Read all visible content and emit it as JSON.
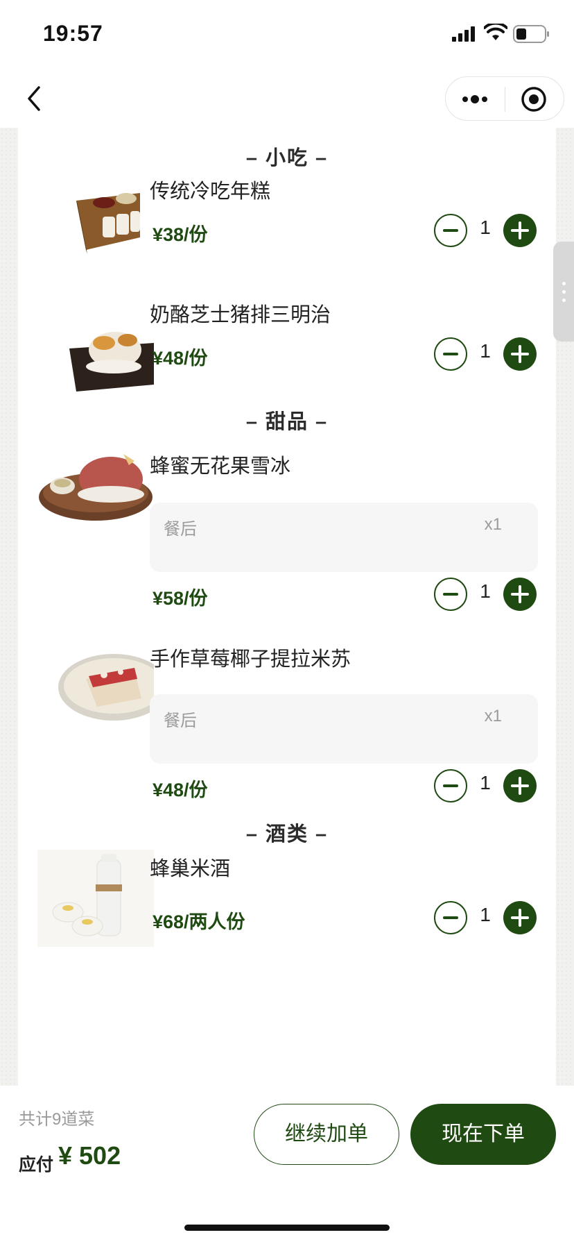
{
  "status_bar": {
    "time": "19:57"
  },
  "sections": [
    {
      "title": "– 小吃 –"
    },
    {
      "title": "– 甜品 –"
    },
    {
      "title": "– 酒类 –"
    }
  ],
  "dishes": [
    {
      "name": "传统冷吃年糕",
      "price": "¥38/份",
      "qty": "1"
    },
    {
      "name": "奶酪芝士猪排三明治",
      "price": "¥48/份",
      "qty": "1"
    },
    {
      "name": "蜂蜜无花果雪冰",
      "price": "¥58/份",
      "qty": "1",
      "note": "餐后",
      "note_count": "x1"
    },
    {
      "name": "手作草莓椰子提拉米苏",
      "price": "¥48/份",
      "qty": "1",
      "note": "餐后",
      "note_count": "x1"
    },
    {
      "name": "蜂巢米酒",
      "price": "¥68/两人份",
      "qty": "1"
    }
  ],
  "bottom": {
    "total_count": "共计9道菜",
    "pay_label": "应付",
    "pay_amount": "¥ 502",
    "continue_label": "继续加单",
    "order_label": "现在下单"
  },
  "colors": {
    "accent": "#1f4a12",
    "note_bg": "#f6f6f6",
    "muted": "#9a9a9a"
  }
}
